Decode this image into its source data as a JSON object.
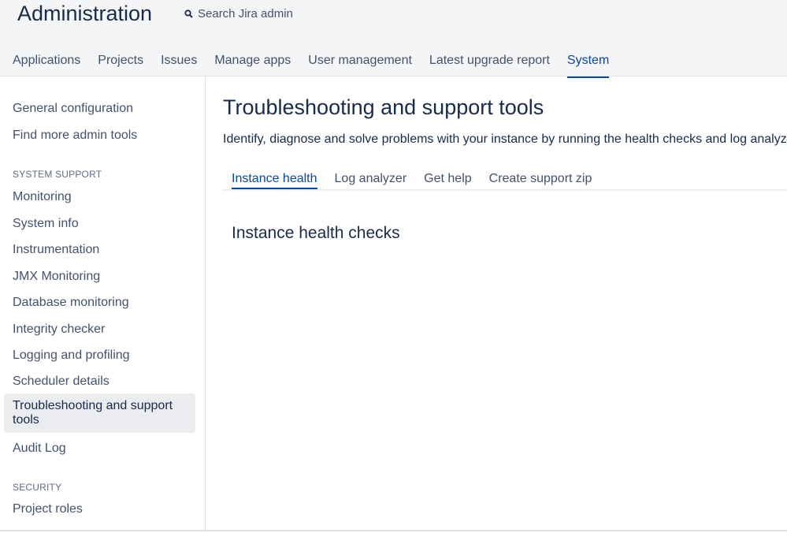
{
  "header": {
    "title": "Administration",
    "search_label": "Search Jira admin",
    "search_icon": "search-icon",
    "nav": [
      {
        "label": "Applications"
      },
      {
        "label": "Projects"
      },
      {
        "label": "Issues"
      },
      {
        "label": "Manage apps"
      },
      {
        "label": "User management"
      },
      {
        "label": "Latest upgrade report"
      },
      {
        "label": "System",
        "active": true
      }
    ]
  },
  "sidebar": {
    "top_links": [
      "General configuration",
      "Find more admin tools"
    ],
    "sections": [
      {
        "heading": "SYSTEM SUPPORT",
        "items": [
          "Monitoring",
          "System info",
          "Instrumentation",
          "JMX Monitoring",
          "Database monitoring",
          "Integrity checker",
          "Logging and profiling",
          "Scheduler details",
          "Troubleshooting and support tools",
          "Audit Log"
        ],
        "selected_index": 8
      },
      {
        "heading": "SECURITY",
        "items": [
          "Project roles"
        ]
      }
    ]
  },
  "main": {
    "title": "Troubleshooting and support tools",
    "description": "Identify, diagnose and solve problems with your instance by running the health checks and log analyzer.",
    "tabs": [
      {
        "label": "Instance health",
        "active": true
      },
      {
        "label": "Log analyzer"
      },
      {
        "label": "Get help"
      },
      {
        "label": "Create support zip"
      }
    ],
    "section_title": "Instance health checks"
  },
  "colors": {
    "accent": "#0747a6",
    "header_bg": "#f4f5f7",
    "selected_bg": "#ebecf0",
    "text": "#172b4d",
    "muted_text": "#42526e"
  }
}
